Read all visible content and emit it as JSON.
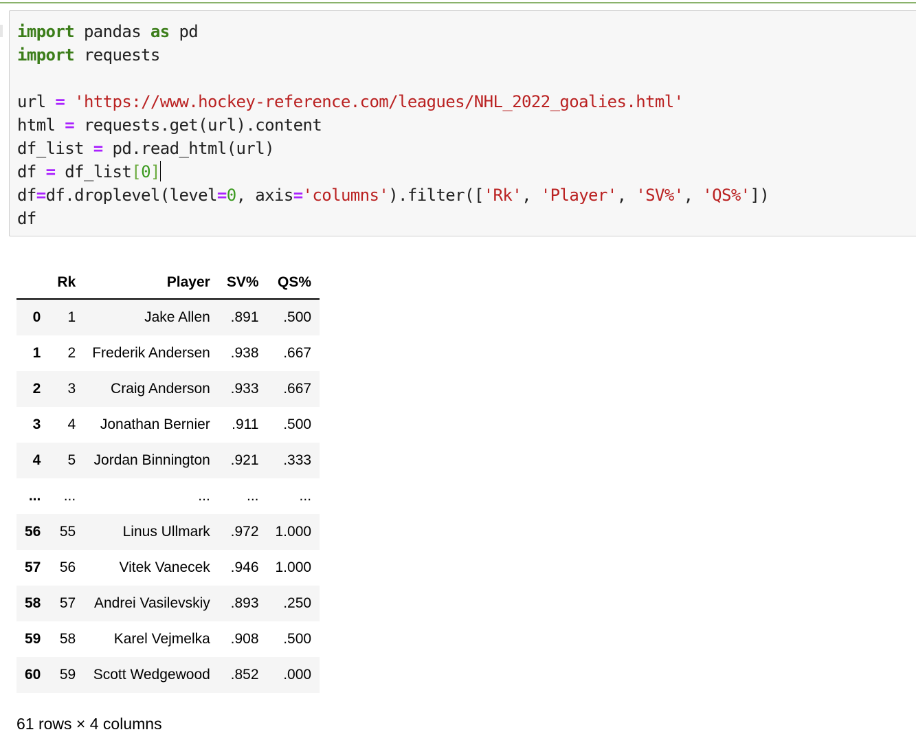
{
  "code_cell": {
    "lines": [
      [
        {
          "t": "kw",
          "v": "import"
        },
        {
          "t": "plain",
          "v": " pandas "
        },
        {
          "t": "kw",
          "v": "as"
        },
        {
          "t": "plain",
          "v": " pd"
        }
      ],
      [
        {
          "t": "kw",
          "v": "import"
        },
        {
          "t": "plain",
          "v": " requests"
        }
      ],
      [],
      [
        {
          "t": "plain",
          "v": "url "
        },
        {
          "t": "op",
          "v": "="
        },
        {
          "t": "plain",
          "v": " "
        },
        {
          "t": "str",
          "v": "'https://www.hockey-reference.com/leagues/NHL_2022_goalies.html'"
        }
      ],
      [
        {
          "t": "plain",
          "v": "html "
        },
        {
          "t": "op",
          "v": "="
        },
        {
          "t": "plain",
          "v": " requests.get(url).content"
        }
      ],
      [
        {
          "t": "plain",
          "v": "df_list "
        },
        {
          "t": "op",
          "v": "="
        },
        {
          "t": "plain",
          "v": " pd.read_html(url)"
        }
      ],
      [
        {
          "t": "plain",
          "v": "df "
        },
        {
          "t": "op",
          "v": "="
        },
        {
          "t": "plain",
          "v": " df_list"
        },
        {
          "t": "br",
          "v": "["
        },
        {
          "t": "num",
          "v": "0"
        },
        {
          "t": "br",
          "v": "]"
        },
        {
          "t": "cursor",
          "v": ""
        }
      ],
      [
        {
          "t": "plain",
          "v": "df"
        },
        {
          "t": "op",
          "v": "="
        },
        {
          "t": "plain",
          "v": "df.droplevel(level"
        },
        {
          "t": "op",
          "v": "="
        },
        {
          "t": "num",
          "v": "0"
        },
        {
          "t": "plain",
          "v": ", axis"
        },
        {
          "t": "op",
          "v": "="
        },
        {
          "t": "str",
          "v": "'columns'"
        },
        {
          "t": "plain",
          "v": ").filter(["
        },
        {
          "t": "str",
          "v": "'Rk'"
        },
        {
          "t": "plain",
          "v": ", "
        },
        {
          "t": "str",
          "v": "'Player'"
        },
        {
          "t": "plain",
          "v": ", "
        },
        {
          "t": "str",
          "v": "'SV%'"
        },
        {
          "t": "plain",
          "v": ", "
        },
        {
          "t": "str",
          "v": "'QS%'"
        },
        {
          "t": "plain",
          "v": "])"
        }
      ],
      [
        {
          "t": "plain",
          "v": "df"
        }
      ]
    ]
  },
  "dataframe": {
    "columns": [
      "",
      "Rk",
      "Player",
      "SV%",
      "QS%"
    ],
    "rows": [
      {
        "index": "0",
        "cells": [
          "1",
          "Jake Allen",
          ".891",
          ".500"
        ]
      },
      {
        "index": "1",
        "cells": [
          "2",
          "Frederik Andersen",
          ".938",
          ".667"
        ]
      },
      {
        "index": "2",
        "cells": [
          "3",
          "Craig Anderson",
          ".933",
          ".667"
        ]
      },
      {
        "index": "3",
        "cells": [
          "4",
          "Jonathan Bernier",
          ".911",
          ".500"
        ]
      },
      {
        "index": "4",
        "cells": [
          "5",
          "Jordan Binnington",
          ".921",
          ".333"
        ]
      },
      {
        "index": "...",
        "cells": [
          "...",
          "...",
          "...",
          "..."
        ]
      },
      {
        "index": "56",
        "cells": [
          "55",
          "Linus Ullmark",
          ".972",
          "1.000"
        ]
      },
      {
        "index": "57",
        "cells": [
          "56",
          "Vitek Vanecek",
          ".946",
          "1.000"
        ]
      },
      {
        "index": "58",
        "cells": [
          "57",
          "Andrei Vasilevskiy",
          ".893",
          ".250"
        ]
      },
      {
        "index": "59",
        "cells": [
          "58",
          "Karel Vejmelka",
          ".908",
          ".500"
        ]
      },
      {
        "index": "60",
        "cells": [
          "59",
          "Scott Wedgewood",
          ".852",
          ".000"
        ]
      }
    ],
    "shape_label": "61 rows × 4 columns"
  }
}
